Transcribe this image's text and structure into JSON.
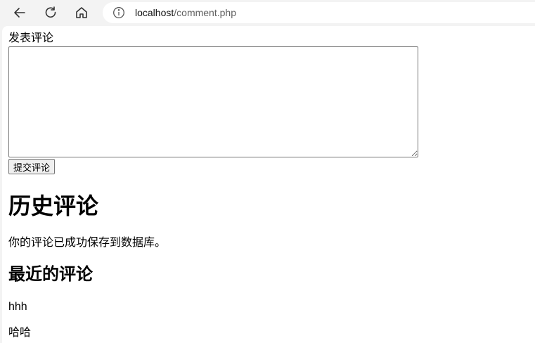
{
  "browser": {
    "url_host": "localhost",
    "url_path": "/comment.php"
  },
  "form": {
    "label": "发表评论",
    "textarea_value": "",
    "submit_label": "提交评论"
  },
  "history": {
    "title": "历史评论",
    "status_message": "你的评论已成功保存到数据库。",
    "recent_title": "最近的评论",
    "comments": [
      "hhh",
      "哈哈"
    ]
  }
}
